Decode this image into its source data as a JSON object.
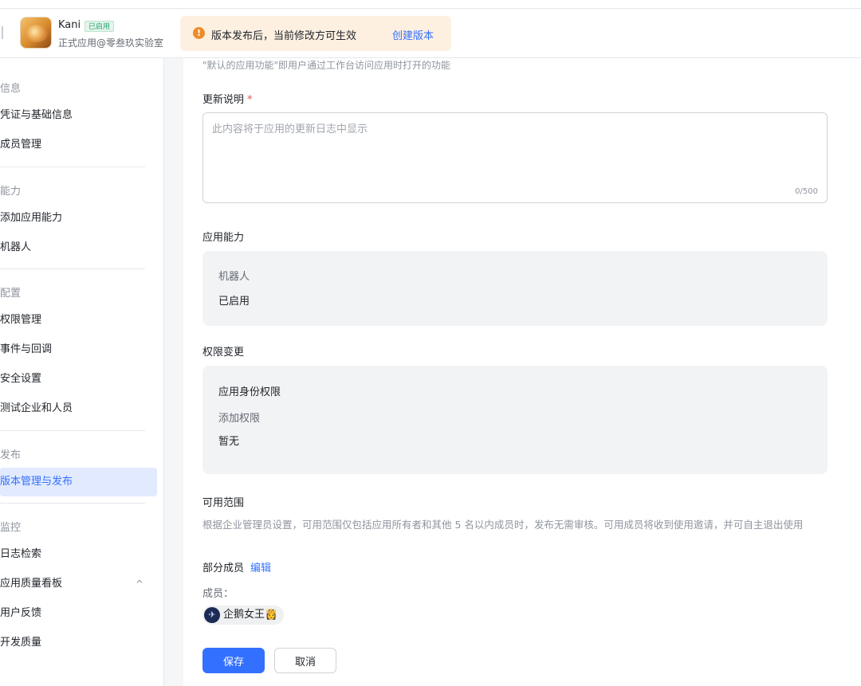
{
  "app": {
    "name": "Kani",
    "badge": "已启用",
    "subtitle": "正式应用@零叁玖实验室",
    "logo_icon": "app-food-logo"
  },
  "notice": {
    "icon": "warning-circle-icon",
    "icon_glyph": "!",
    "text": "版本发布后，当前修改方可生效",
    "link": "创建版本",
    "bg_color": "#fdf0e1",
    "icon_color": "#ed8c2b"
  },
  "sidebar": {
    "groups": [
      {
        "label": "信息"
      },
      {
        "label": "能力"
      },
      {
        "label": "配置"
      },
      {
        "label": "发布"
      },
      {
        "label": "监控"
      }
    ],
    "items": [
      {
        "label": "凭证与基础信息"
      },
      {
        "label": "成员管理"
      },
      {
        "label": "添加应用能力"
      },
      {
        "label": "机器人"
      },
      {
        "label": "权限管理"
      },
      {
        "label": "事件与回调"
      },
      {
        "label": "安全设置"
      },
      {
        "label": "测试企业和人员"
      },
      {
        "label": "版本管理与发布",
        "active": true
      },
      {
        "label": "日志检索"
      },
      {
        "label": "应用质量看板",
        "chevron": "^"
      },
      {
        "label": "用户反馈"
      },
      {
        "label": "开发质量"
      }
    ]
  },
  "form": {
    "top_hint": "\"默认的应用功能\"即用户通过工作台访问应用时打开的功能",
    "update_notes": {
      "label": "更新说明",
      "required_mark": "*",
      "placeholder": "此内容将于应用的更新日志中显示",
      "counter": "0/500"
    },
    "capability": {
      "label": "应用能力",
      "item_title": "机器人",
      "item_status": "已启用"
    },
    "permissions": {
      "label": "权限变更",
      "scope_title": "应用身份权限",
      "add_label": "添加权限",
      "add_value": "暂无"
    },
    "availability": {
      "label": "可用范围",
      "description": "根据企业管理员设置，可用范围仅包括应用所有者和其他 5 名以内成员时，发布无需审核。可用成员将收到使用邀请，并可自主退出使用",
      "scope_value": "部分成员",
      "edit_link": "编辑",
      "members_label": "成员：",
      "member_name": "企鹅女王👸",
      "member_avatar_glyph": "✈"
    },
    "save_button": "保存",
    "cancel_button": "取消"
  },
  "colors": {
    "accent": "#3370ff",
    "active_bg": "#e1eaff",
    "badge_green": "#2ba471",
    "required": "#f54a45"
  }
}
